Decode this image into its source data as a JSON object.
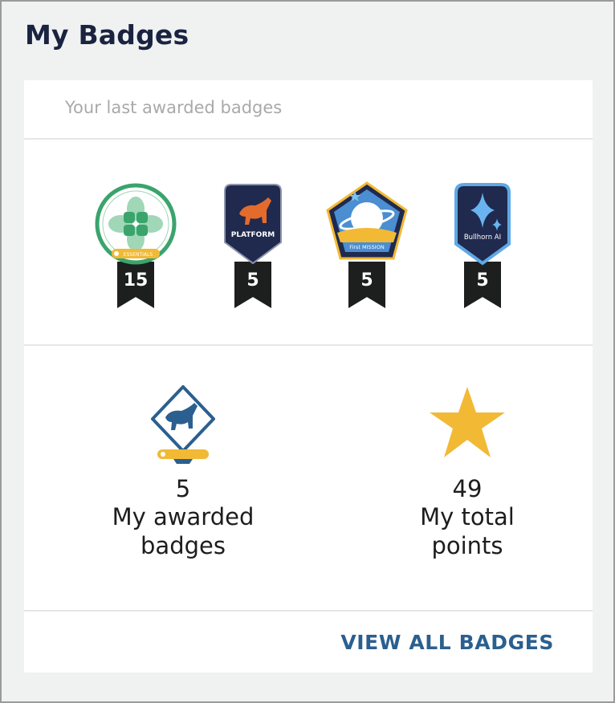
{
  "header": {
    "title": "My Badges"
  },
  "recent": {
    "subtitle": "Your last awarded badges",
    "badges": [
      {
        "name": "Essentials",
        "icon": "green-flower-icon",
        "count": "15",
        "caption": "ESSENTIALS"
      },
      {
        "name": "Platform",
        "icon": "bull-icon",
        "count": "5",
        "caption": "PLATFORM"
      },
      {
        "name": "First Mission",
        "icon": "planet-icon",
        "count": "5",
        "caption": "First MISSION"
      },
      {
        "name": "Bullhorn AI",
        "icon": "sparkle-icon",
        "count": "5",
        "caption": "Bullhorn AI"
      }
    ]
  },
  "stats": {
    "awarded": {
      "value": "5",
      "label_line1": "My awarded",
      "label_line2": "badges",
      "icon": "bull-badge-icon"
    },
    "points": {
      "value": "49",
      "label_line1": "My total",
      "label_line2": "points",
      "icon": "star-icon",
      "color": "#f2b935"
    }
  },
  "footer": {
    "view_all_label": "VIEW ALL BADGES"
  },
  "colors": {
    "title": "#1a2340",
    "link": "#2b5f8f",
    "ribbon": "#1c1f1d",
    "navy": "#1f2a4e",
    "gold": "#f2b935",
    "green": "#3aa46c"
  }
}
